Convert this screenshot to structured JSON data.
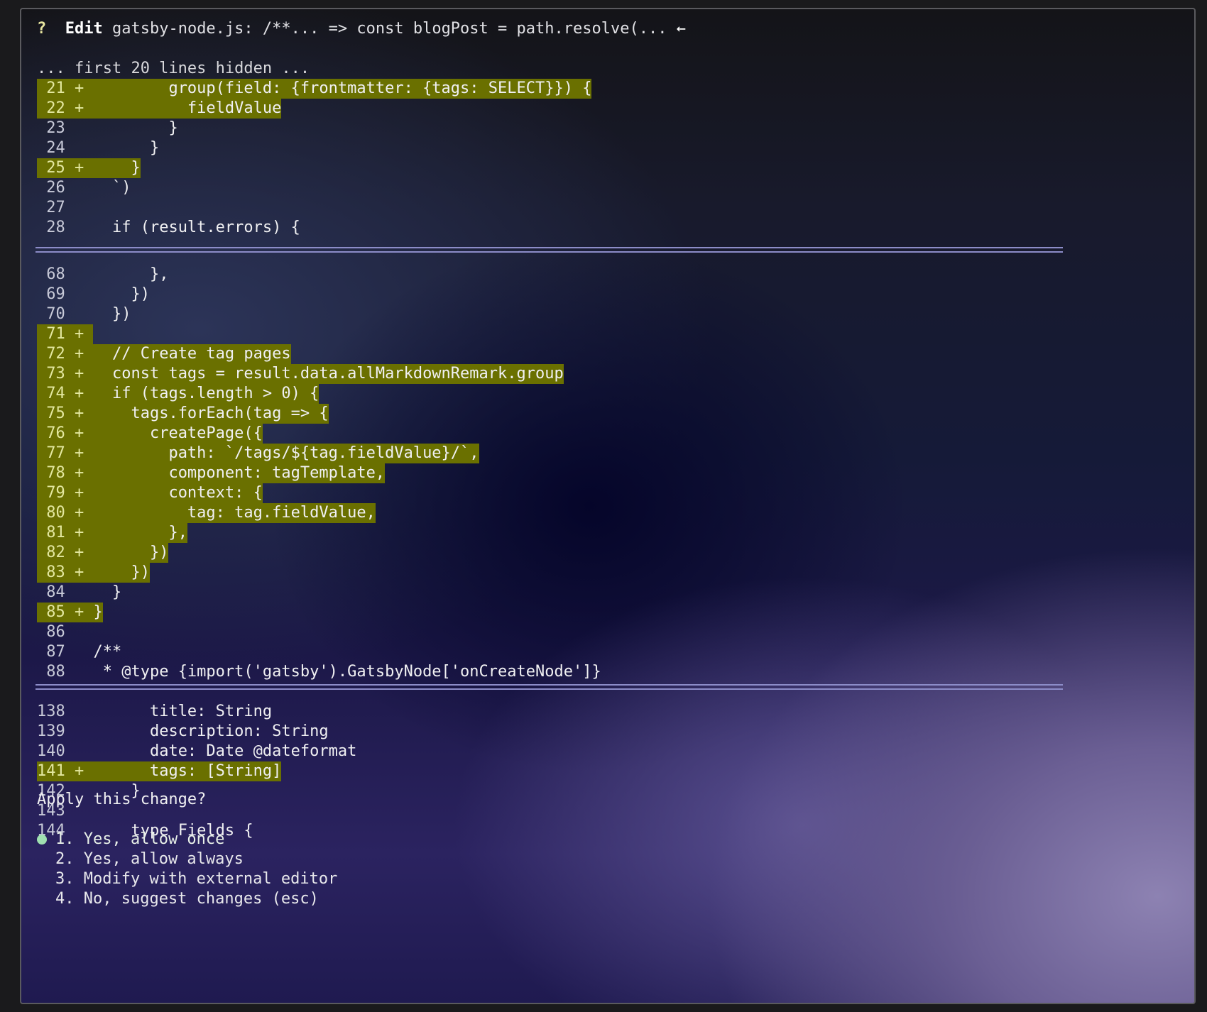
{
  "header": {
    "prompt_icon": "?",
    "action": "Edit",
    "file_summary": "gatsby-node.js: /**... => const blogPost = path.resolve(...",
    "arrow_icon": "←"
  },
  "hidden_note": "... first 20 lines hidden ...",
  "hunks": [
    {
      "lines": [
        {
          "num": "21",
          "mark": "+",
          "added": true,
          "text": "        group(field: {frontmatter: {tags: SELECT}}) {"
        },
        {
          "num": "22",
          "mark": "+",
          "added": true,
          "text": "          fieldValue"
        },
        {
          "num": "23",
          "mark": " ",
          "added": false,
          "text": "        }"
        },
        {
          "num": "24",
          "mark": " ",
          "added": false,
          "text": "      }"
        },
        {
          "num": "25",
          "mark": "+",
          "added": true,
          "text": "    }"
        },
        {
          "num": "26",
          "mark": " ",
          "added": false,
          "text": "  `)"
        },
        {
          "num": "27",
          "mark": " ",
          "added": false,
          "text": ""
        },
        {
          "num": "28",
          "mark": " ",
          "added": false,
          "text": "  if (result.errors) {"
        }
      ]
    },
    {
      "lines": [
        {
          "num": "68",
          "mark": " ",
          "added": false,
          "text": "      },"
        },
        {
          "num": "69",
          "mark": " ",
          "added": false,
          "text": "    })"
        },
        {
          "num": "70",
          "mark": " ",
          "added": false,
          "text": "  })"
        },
        {
          "num": "71",
          "mark": "+",
          "added": true,
          "text": ""
        },
        {
          "num": "72",
          "mark": "+",
          "added": true,
          "text": "  // Create tag pages"
        },
        {
          "num": "73",
          "mark": "+",
          "added": true,
          "text": "  const tags = result.data.allMarkdownRemark.group"
        },
        {
          "num": "74",
          "mark": "+",
          "added": true,
          "text": "  if (tags.length > 0) {"
        },
        {
          "num": "75",
          "mark": "+",
          "added": true,
          "text": "    tags.forEach(tag => {"
        },
        {
          "num": "76",
          "mark": "+",
          "added": true,
          "text": "      createPage({"
        },
        {
          "num": "77",
          "mark": "+",
          "added": true,
          "text": "        path: `/tags/${tag.fieldValue}/`,"
        },
        {
          "num": "78",
          "mark": "+",
          "added": true,
          "text": "        component: tagTemplate,"
        },
        {
          "num": "79",
          "mark": "+",
          "added": true,
          "text": "        context: {"
        },
        {
          "num": "80",
          "mark": "+",
          "added": true,
          "text": "          tag: tag.fieldValue,"
        },
        {
          "num": "81",
          "mark": "+",
          "added": true,
          "text": "        },"
        },
        {
          "num": "82",
          "mark": "+",
          "added": true,
          "text": "      })"
        },
        {
          "num": "83",
          "mark": "+",
          "added": true,
          "text": "    })"
        },
        {
          "num": "84",
          "mark": " ",
          "added": false,
          "text": "  }"
        },
        {
          "num": "85",
          "mark": "+",
          "added": true,
          "text": "}"
        },
        {
          "num": "86",
          "mark": " ",
          "added": false,
          "text": ""
        },
        {
          "num": "87",
          "mark": " ",
          "added": false,
          "text": "/**"
        },
        {
          "num": "88",
          "mark": " ",
          "added": false,
          "text": " * @type {import('gatsby').GatsbyNode['onCreateNode']}"
        }
      ]
    },
    {
      "lines": [
        {
          "num": "138",
          "mark": " ",
          "added": false,
          "text": "      title: String"
        },
        {
          "num": "139",
          "mark": " ",
          "added": false,
          "text": "      description: String"
        },
        {
          "num": "140",
          "mark": " ",
          "added": false,
          "text": "      date: Date @dateformat"
        },
        {
          "num": "141",
          "mark": "+",
          "added": true,
          "text": "      tags: [String]"
        },
        {
          "num": "142",
          "mark": " ",
          "added": false,
          "text": "    }"
        },
        {
          "num": "143",
          "mark": " ",
          "added": false,
          "text": ""
        },
        {
          "num": "144",
          "mark": " ",
          "added": false,
          "text": "    type Fields {"
        }
      ]
    }
  ],
  "prompt": "Apply this change?",
  "options": [
    {
      "label": "1. Yes, allow once",
      "selected": true
    },
    {
      "label": "2. Yes, allow always",
      "selected": false
    },
    {
      "label": "3. Modify with external editor",
      "selected": false
    },
    {
      "label": "4. No, suggest changes (esc)",
      "selected": false
    }
  ],
  "colors": {
    "added_bg": "#6a7000",
    "separator": "#8c8cc8",
    "selected_bullet": "#9fe0b0"
  }
}
